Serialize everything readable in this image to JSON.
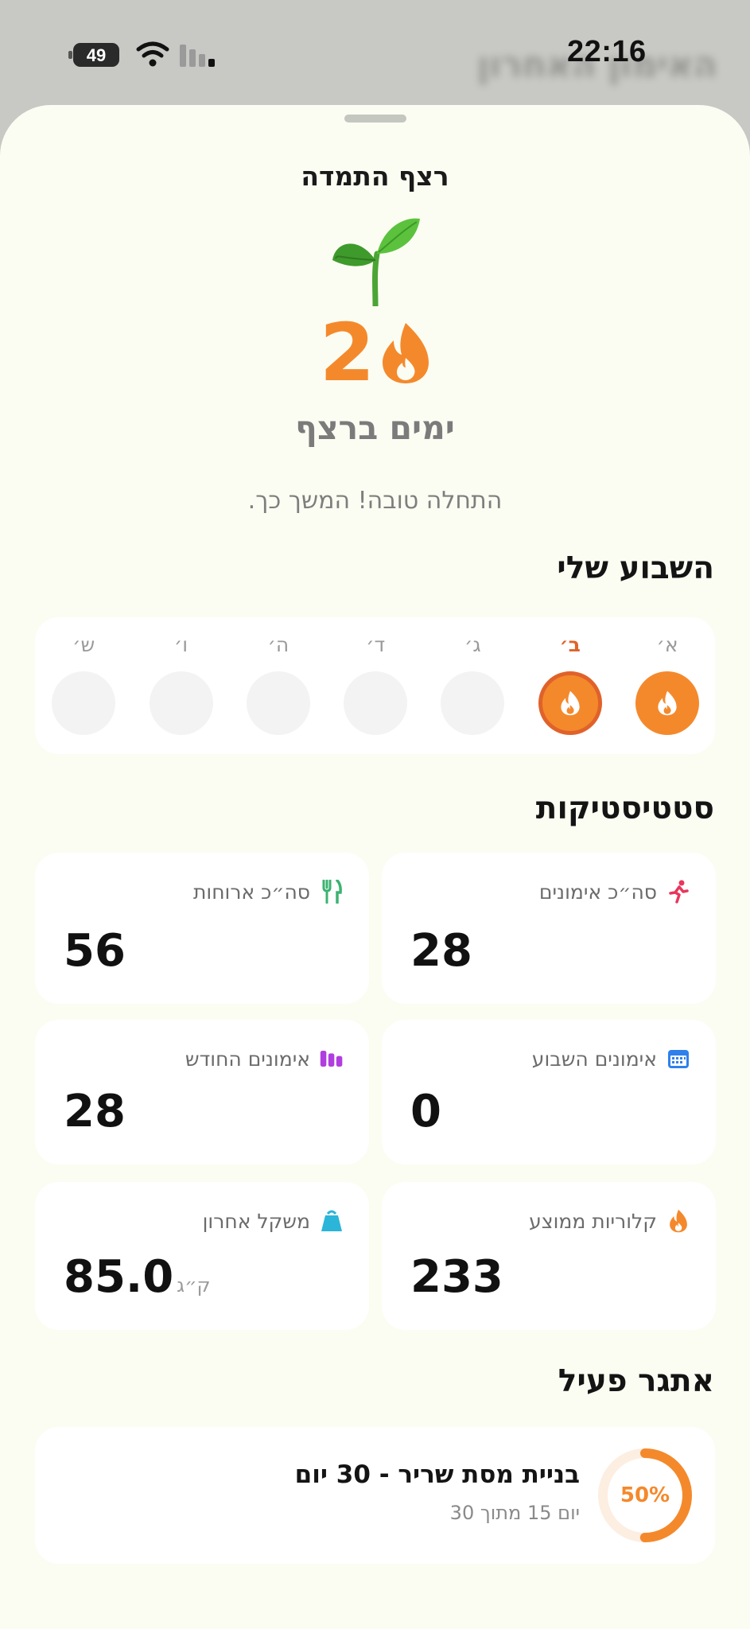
{
  "status_bar": {
    "time": "22:16",
    "battery": "49",
    "background_title": "האימון האחרון"
  },
  "sheet": {
    "title": "רצף התמדה",
    "streak_days": "2",
    "streak_caption": "ימים ברצף",
    "encouragement": "התחלה טובה! המשך כך."
  },
  "week": {
    "title": "השבוע שלי",
    "days": [
      {
        "label": "א׳",
        "state": "done"
      },
      {
        "label": "ב׳",
        "state": "today"
      },
      {
        "label": "ג׳",
        "state": "empty"
      },
      {
        "label": "ד׳",
        "state": "empty"
      },
      {
        "label": "ה׳",
        "state": "empty"
      },
      {
        "label": "ו׳",
        "state": "empty"
      },
      {
        "label": "ש׳",
        "state": "empty"
      }
    ]
  },
  "stats": {
    "title": "סטטיסטיקות",
    "total_workouts": {
      "label": "סה״כ אימונים",
      "value": "28",
      "icon": "running-icon",
      "color": "#e8365d"
    },
    "total_meals": {
      "label": "סה״כ ארוחות",
      "value": "56",
      "icon": "fork-knife-icon",
      "color": "#3cb371"
    },
    "week_workouts": {
      "label": "אימונים השבוע",
      "value": "0",
      "icon": "calendar-icon",
      "color": "#2f80ed"
    },
    "month_workouts": {
      "label": "אימונים החודש",
      "value": "28",
      "icon": "bar-chart-icon",
      "color": "#b13de0"
    },
    "avg_calories": {
      "label": "קלוריות ממוצע",
      "value": "233",
      "icon": "flame-icon",
      "color": "#f4892c"
    },
    "last_weight": {
      "label": "משקל אחרון",
      "value": "85.0",
      "unit": "ק״ג",
      "icon": "scale-icon",
      "color": "#2bb5d8"
    }
  },
  "challenge": {
    "title": "אתגר פעיל",
    "name": "בניית מסת שריר - 30 יום",
    "progress_text": "יום 15 מתוך 30",
    "percent_label": "50%",
    "percent": 0.5
  },
  "colors": {
    "accent": "#f4892c",
    "today": "#e0622a",
    "sheet_bg": "#fbfdf2"
  }
}
